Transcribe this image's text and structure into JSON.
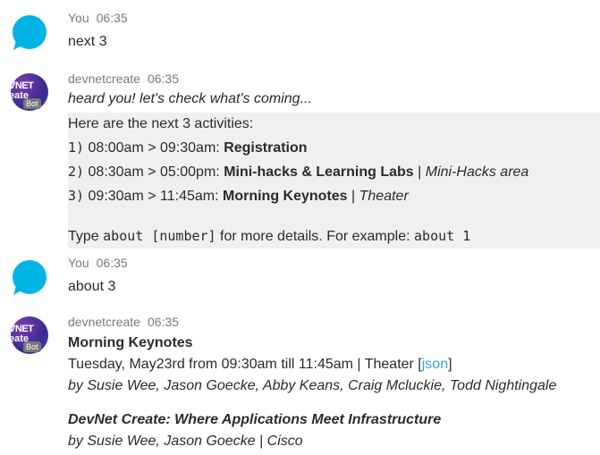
{
  "messages": [
    {
      "sender": "You",
      "time": "06:35",
      "text": "next 3"
    },
    {
      "sender": "devnetcreate",
      "time": "06:35",
      "avatar_line1": "VNET",
      "avatar_line2": "eate",
      "badge": "Bot",
      "intro": "heard you! let's check what's coming...",
      "panel": {
        "heading": "Here are the next 3 activities:",
        "items": [
          {
            "num": "1)",
            "time": "08:00am > 09:30am:",
            "title": "Registration",
            "sep": "",
            "location": ""
          },
          {
            "num": "2)",
            "time": "08:30am > 05:00pm:",
            "title": "Mini-hacks & Learning Labs",
            "sep": "|",
            "location": "Mini-Hacks area"
          },
          {
            "num": "3)",
            "time": "09:30am > 11:45am:",
            "title": "Morning Keynotes",
            "sep": "|",
            "location": "Theater"
          }
        ],
        "hint_prefix": "Type",
        "hint_code": "about [number]",
        "hint_mid": "for more details. For example:",
        "hint_example": "about 1"
      }
    },
    {
      "sender": "You",
      "time": "06:35",
      "text": "about 3"
    },
    {
      "sender": "devnetcreate",
      "time": "06:35",
      "avatar_line1": "VNET",
      "avatar_line2": "eate",
      "badge": "Bot",
      "title": "Morning Keynotes",
      "details": "Tuesday, May23rd from 09:30am till 11:45am | Theater [",
      "link": "json",
      "details_end": "]",
      "speakers": "by Susie Wee, Jason Goecke, Abby Keans, Craig Mcluckie, Todd Nightingale",
      "talk_title": "DevNet Create: Where Applications Meet Infrastructure",
      "talk_speakers": "by Susie Wee, Jason Goecke | Cisco"
    }
  ],
  "colors": {
    "user_avatar": "#00b4e6",
    "panel_bg": "#f0f0f0",
    "link": "#2aa7d9"
  },
  "icons": {
    "user_avatar": "chat-bubble-icon",
    "bot_avatar": "devnet-create-logo"
  }
}
